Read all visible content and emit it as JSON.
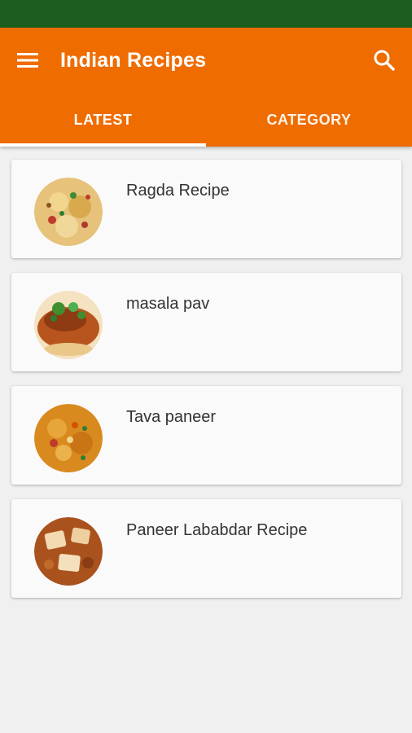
{
  "app": {
    "title": "Indian Recipes",
    "colors": {
      "status_bar": "#1b5e20",
      "app_bar": "#ef6c00",
      "tab_indicator": "#ffffff",
      "background": "#f0f0f0"
    }
  },
  "toolbar": {
    "menu_icon": "hamburger-menu-icon",
    "search_icon": "search-icon"
  },
  "tabs": [
    {
      "label": "LATEST",
      "selected": true
    },
    {
      "label": "CATEGORY",
      "selected": false
    }
  ],
  "recipes": [
    {
      "title": "Ragda Recipe"
    },
    {
      "title": "masala pav"
    },
    {
      "title": "Tava paneer"
    },
    {
      "title": "Paneer Lababdar Recipe"
    }
  ]
}
